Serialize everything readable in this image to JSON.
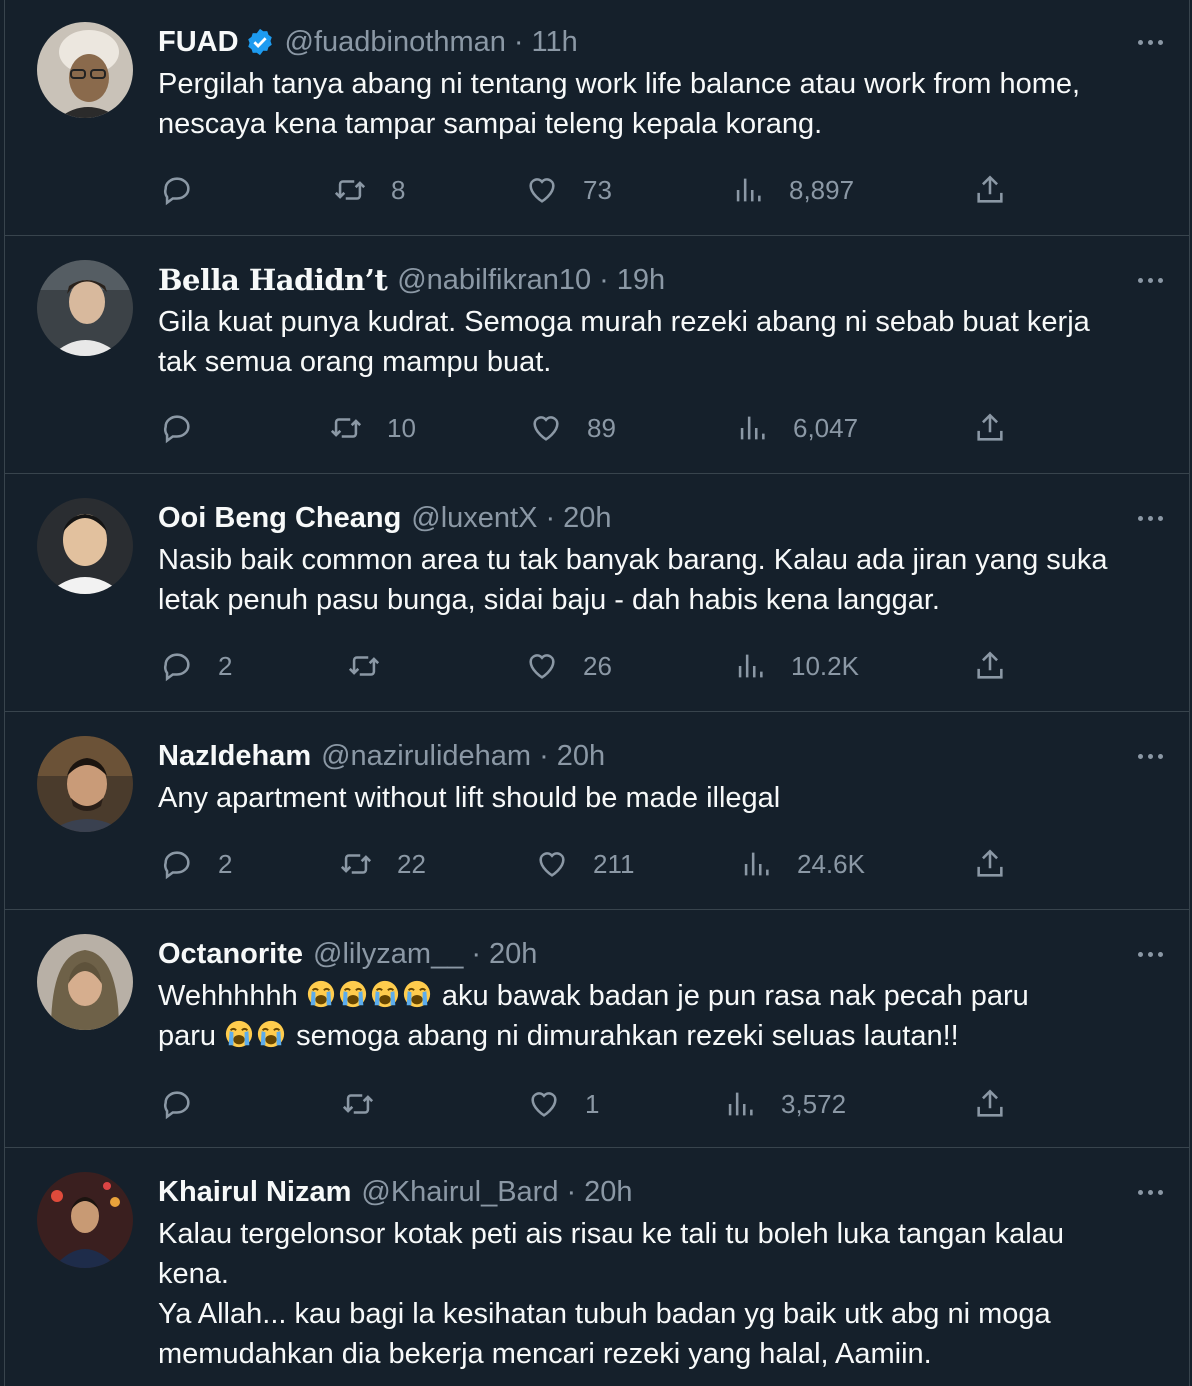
{
  "colors": {
    "background": "#15202b",
    "text": "#f7f9f9",
    "muted": "#8b98a5",
    "divider": "#38444d",
    "verified": "#1d9bf0"
  },
  "icons": {
    "reply": "reply-icon",
    "retweet": "retweet-icon",
    "like": "heart-icon",
    "views": "views-icon",
    "share": "share-icon",
    "more": "more-icon",
    "verified": "verified-badge-icon",
    "emoji": "loudly-crying-face-emoji"
  },
  "tweets": [
    {
      "name": "FUAD",
      "verified": true,
      "handle": "@fuadbinothman",
      "time": "11h",
      "lines": [
        "Pergilah tanya abang ni tentang work life balance atau work from home,",
        "nescaya kena tampar sampai teleng kepala korang."
      ],
      "replies": "",
      "retweets": "8",
      "likes": "73",
      "views": "8,897"
    },
    {
      "name": "Bella Hadidn’t",
      "handle": "@nabilfikran10",
      "time": "19h",
      "lines": [
        "Gila kuat punya kudrat. Semoga murah rezeki abang ni sebab buat kerja",
        "tak semua orang mampu buat."
      ],
      "replies": "",
      "retweets": "10",
      "likes": "89",
      "views": "6,047"
    },
    {
      "name": "Ooi Beng Cheang",
      "handle": "@luxentX",
      "time": "20h",
      "lines": [
        "Nasib baik common area tu tak banyak barang. Kalau ada jiran yang suka",
        "letak penuh pasu bunga, sidai baju - dah habis kena langgar."
      ],
      "replies": "2",
      "retweets": "",
      "likes": "26",
      "views": "10.2K"
    },
    {
      "name": "NazIdeham",
      "handle": "@nazirulideham",
      "time": "20h",
      "lines": [
        "Any apartment without lift should be made illegal"
      ],
      "replies": "2",
      "retweets": "22",
      "likes": "211",
      "views": "24.6K"
    },
    {
      "name": "Octanorite",
      "handle": "@lilyzam__",
      "time": "20h",
      "line1_a": "Wehhhhhh",
      "line1_b": "aku bawak badan je pun rasa nak pecah paru",
      "line2_a": "paru",
      "line2_b": "semoga abang ni dimurahkan rezeki seluas lautan!!",
      "replies": "",
      "retweets": "",
      "likes": "1",
      "views": "3,572"
    },
    {
      "name": "Khairul Nizam",
      "handle": "@Khairul_Bard",
      "time": "20h",
      "lines": [
        "Kalau tergelonsor kotak peti ais risau ke tali tu boleh luka tangan kalau",
        "kena.",
        "Ya Allah... kau bagi la kesihatan tubuh badan yg baik utk abg ni moga",
        "memudahkan dia bekerja mencari rezeki yang halal, Aamiin."
      ]
    }
  ]
}
